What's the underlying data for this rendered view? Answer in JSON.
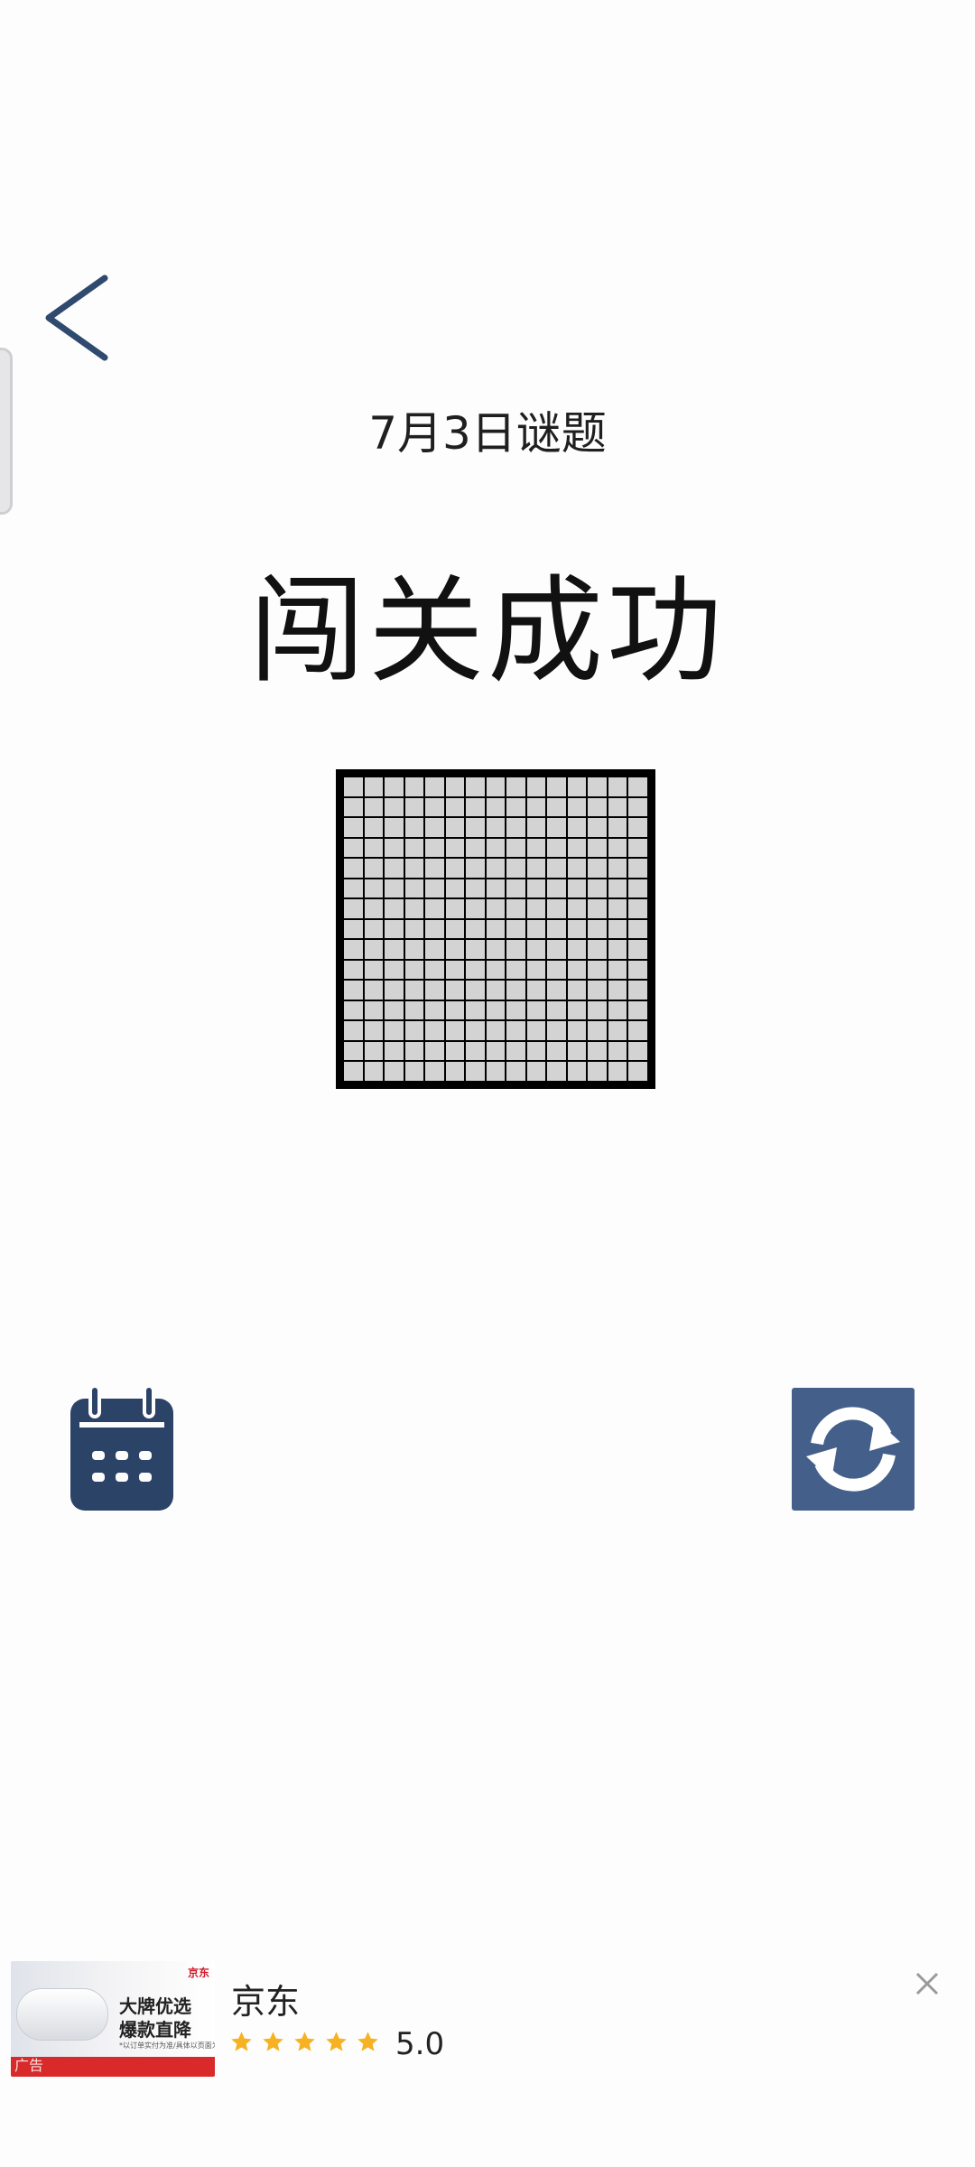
{
  "header": {
    "puzzle_date": "7月3日谜题",
    "result_title": "闯关成功"
  },
  "icons": {
    "back": "chevron-left-icon",
    "calendar": "calendar-icon",
    "refresh": "refresh-icon",
    "close": "close-icon",
    "star": "star-icon"
  },
  "colors": {
    "accent": "#44608a",
    "calendar": "#2b4366",
    "filled_cell": "#000000",
    "empty_cell": "#d3d3d3",
    "star": "#f6b222"
  },
  "puzzle": {
    "rows": 15,
    "cols": 15,
    "cells": [
      "000000000000000",
      "000000000000000",
      "000000000000000",
      "000000000000000",
      "000000000000000",
      "000000000000000",
      "000000000000000",
      "000000000000000",
      "000000000000000",
      "000000000000000",
      "000000000000000",
      "000000000000000",
      "000000000000000",
      "000000000000000",
      "000000000000000"
    ]
  },
  "ad": {
    "image_text_1": "大牌优选",
    "image_text_2": "爆款直降",
    "image_fine_print": "*以订单实付为准/具体以页面为准",
    "image_badge": "京东",
    "ad_label": "广告",
    "brand": "京东",
    "rating": "5.0",
    "stars": 5
  }
}
